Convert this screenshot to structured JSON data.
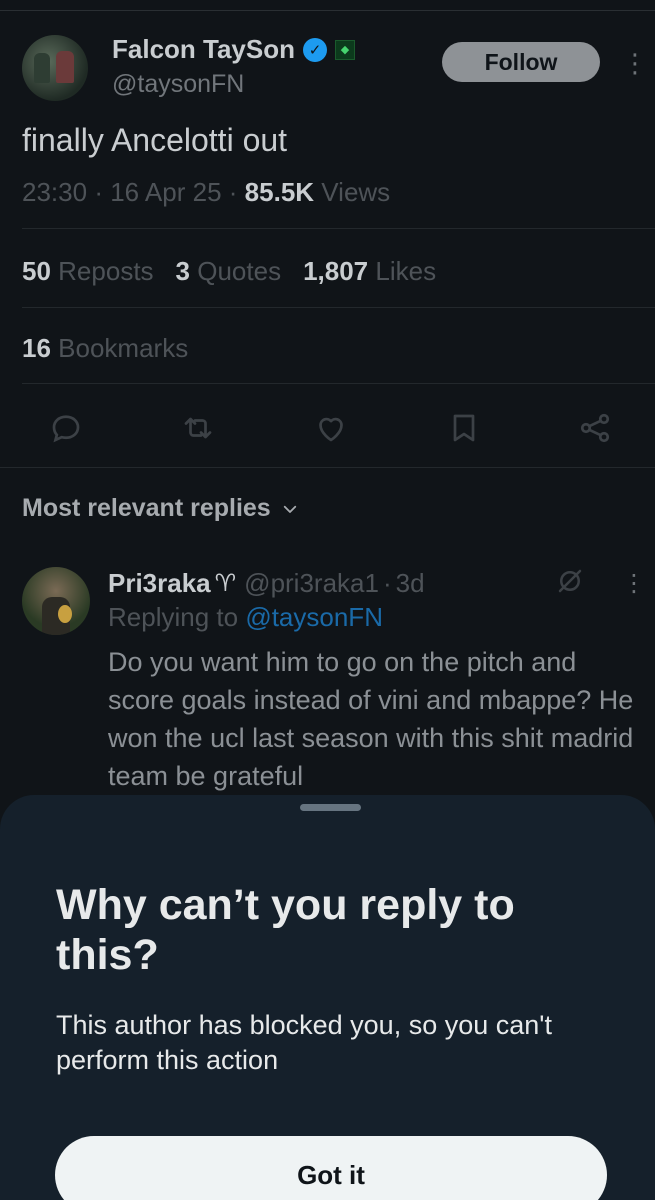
{
  "tweet": {
    "author_name": "Falcon TaySon",
    "author_handle": "@taysonFN",
    "follow_label": "Follow",
    "text": "finally Ancelotti out",
    "time": "23:30",
    "date": "16 Apr 25",
    "separator": "·",
    "views_count": "85.5K",
    "views_label": "Views",
    "reposts_count": "50",
    "reposts_label": "Reposts",
    "quotes_count": "3",
    "quotes_label": "Quotes",
    "likes_count": "1,807",
    "likes_label": "Likes",
    "bookmarks_count": "16",
    "bookmarks_label": "Bookmarks"
  },
  "replies_sort": {
    "label": "Most relevant replies"
  },
  "reply": {
    "author_name": "Pri3raka",
    "author_handle": "@pri3raka1",
    "age": "3d",
    "replying_to_prefix": "Replying to",
    "replying_to_handle": "@taysonFN",
    "text": "Do you want him to go on the pitch and score goals instead of vini and mbappe? He won the ucl last season with this shit madrid team be grateful"
  },
  "sheet": {
    "title": "Why can’t you reply to this?",
    "body": "This author has blocked you, so you can't perform this action",
    "button_label": "Got it"
  },
  "colors": {
    "background_dimmed": "#101418",
    "sheet_background": "#15202b",
    "verified_blue": "#1d9bf0",
    "link_blue": "#1a6aa8",
    "button_light": "#eff3f4"
  }
}
